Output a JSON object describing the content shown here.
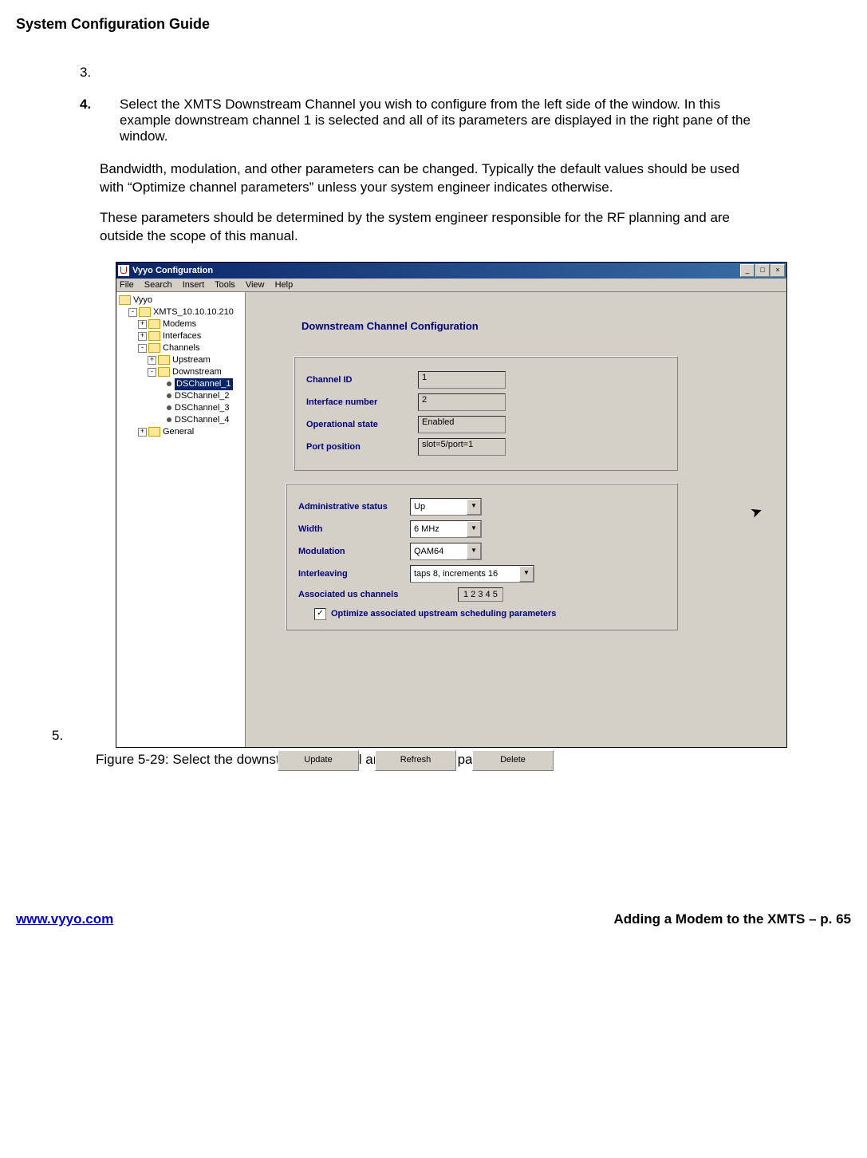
{
  "doc_title": "System Configuration Guide",
  "body": {
    "item3_num": "3.",
    "item3_text": "",
    "item4_num": "4.",
    "item4_text": "Select the XMTS  Downstream Channel  you wish to configure from the left side of the window.  In this example downstream channel 1 is selected and all of its parameters are displayed in the right pane of the window.",
    "para1": "Bandwidth, modulation, and other parameters can be changed.  Typically the default values should be used with “Optimize channel parameters” unless your system engineer indicates otherwise.",
    "para2": "These parameters should be determined by the system engineer responsible for the RF planning and are outside the scope of this manual.",
    "item5_num": "5."
  },
  "window": {
    "title": "Vyyo Configuration",
    "menu": {
      "file": "File",
      "search": "Search",
      "insert": "Insert",
      "tools": "Tools",
      "view": "View",
      "help": "Help"
    },
    "win_min": "_",
    "win_max": "□",
    "win_close": "×"
  },
  "tree": {
    "root": "Vyyo",
    "xmts": "XMTS_10.10.10.210",
    "modems": "Modems",
    "interfaces": "Interfaces",
    "channels": "Channels",
    "upstream": "Upstream",
    "downstream": "Downstream",
    "ds1": "DSChannel_1",
    "ds2": "DSChannel_2",
    "ds3": "DSChannel_3",
    "ds4": "DSChannel_4",
    "general": "General"
  },
  "pane": {
    "title": "Downstream Channel Configuration",
    "labels": {
      "channel_id": "Channel ID",
      "iface_num": "Interface number",
      "op_state": "Operational state",
      "port_pos": "Port position",
      "admin_status": "Administrative status",
      "width": "Width",
      "modulation": "Modulation",
      "interleaving": "Interleaving",
      "assoc_us": "Associated us channels",
      "opt_chk": "Optimize associated upstream scheduling parameters"
    },
    "values": {
      "channel_id": "1",
      "iface_num": "2",
      "op_state": "Enabled",
      "port_pos": "slot=5/port=1",
      "admin_status": "Up",
      "width": "6 MHz",
      "modulation": "QAM64",
      "interleaving": "taps 8, increments 16",
      "assoc_us": "1 2 3 4 5",
      "opt_checked": "✓"
    },
    "buttons": {
      "update": "Update",
      "refresh": "Refresh",
      "delete": "Delete"
    }
  },
  "caption": "Figure 5-29: Select the downstream channel and change its parameters",
  "footer": {
    "url": "www.vyyo.com",
    "right": "Adding a Modem to the XMTS – p. 65"
  }
}
